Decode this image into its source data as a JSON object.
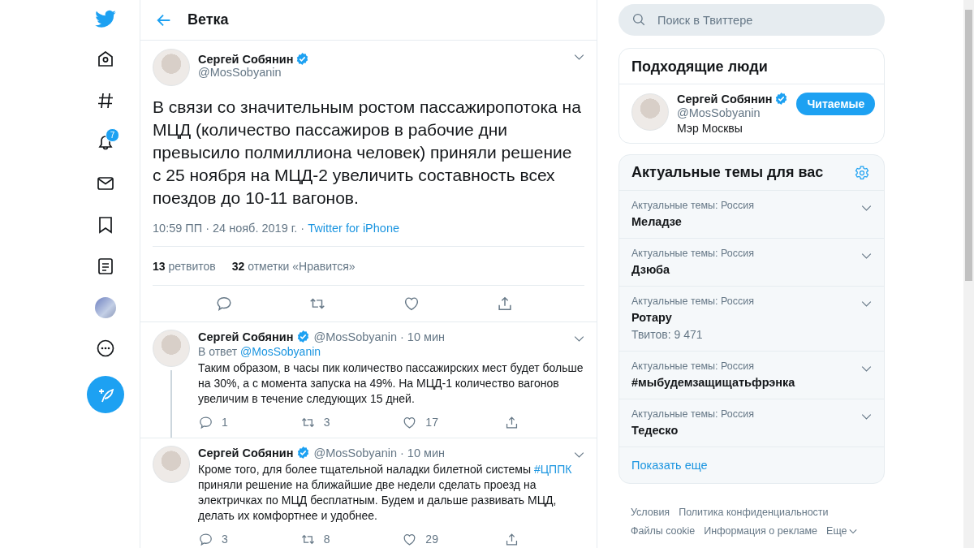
{
  "nav": {
    "notification_badge": "7"
  },
  "header": {
    "title": "Ветка"
  },
  "main_tweet": {
    "name": "Сергей Собянин",
    "verified": true,
    "handle": "@MosSobyanin",
    "text": "В связи со значительным ростом пассажиропотока на МЦД (количество пассажиров в рабочие дни превысило полмиллиона человек) приняли решение с 25 ноября на МЦД-2 увеличить составность всех поездов до 10-11 вагонов.",
    "timestamp": "10:59 ПП · 24 нояб. 2019 г. ·",
    "source": "Twitter for iPhone",
    "stats": [
      {
        "count": "13",
        "label": "ретвитов"
      },
      {
        "count": "32",
        "label": "отметки «Нравится»"
      }
    ]
  },
  "replies": [
    {
      "name": "Сергей Собянин",
      "verified": true,
      "handle": "@MosSobyanin",
      "time": "· 10 мин",
      "reply_prefix": "В ответ",
      "reply_to": "@MosSobyanin",
      "thread_line": true,
      "parts": [
        {
          "text": "Таким образом, в часы пик количество пассажирских мест будет больше на 30%, а с момента запуска на 49%. На МЦД-1 количество вагонов увеличим в течение следующих 15 дней.",
          "link": false
        }
      ],
      "replies": "1",
      "retweets": "3",
      "likes": "17"
    },
    {
      "name": "Сергей Собянин",
      "verified": true,
      "handle": "@MosSobyanin",
      "time": "· 10 мин",
      "thread_line": false,
      "parts": [
        {
          "text": "Кроме того, для более тщательной наладки билетной системы ",
          "link": false
        },
        {
          "text": "#ЦППК",
          "link": true
        },
        {
          "text": " приняли решение на ближайшие две недели сделать проезд на электричках по МЦД бесплатным. Будем и дальше развивать МЦД, делать их комфортнее и удобнее.",
          "link": false
        }
      ],
      "replies": "3",
      "retweets": "8",
      "likes": "29"
    }
  ],
  "search": {
    "placeholder": "Поиск в Твиттере"
  },
  "who_to_follow": {
    "title": "Подходящие люди",
    "person": {
      "name": "Сергей Собянин",
      "verified": true,
      "handle": "@MosSobyanin",
      "bio": "Мэр Москвы",
      "button": "Читаемые"
    }
  },
  "trends": {
    "title": "Актуальные темы для вас",
    "items": [
      {
        "context": "Актуальные темы: Россия",
        "name": "Меладзе"
      },
      {
        "context": "Актуальные темы: Россия",
        "name": "Дзюба"
      },
      {
        "context": "Актуальные темы: Россия",
        "name": "Ротару",
        "count": "Твитов: 9 471"
      },
      {
        "context": "Актуальные темы: Россия",
        "name": "#мыбудемзащищатьфрэнка"
      },
      {
        "context": "Актуальные темы: Россия",
        "name": "Тедеско"
      }
    ],
    "show_more": "Показать еще"
  },
  "footer": [
    {
      "label": "Условия",
      "kind": "link"
    },
    {
      "label": "Политика конфиденциальности",
      "kind": "link"
    },
    {
      "label": "Файлы cookie",
      "kind": "link"
    },
    {
      "label": "Информация о рекламе",
      "kind": "link"
    },
    {
      "label": "Еще",
      "kind": "menu"
    }
  ]
}
